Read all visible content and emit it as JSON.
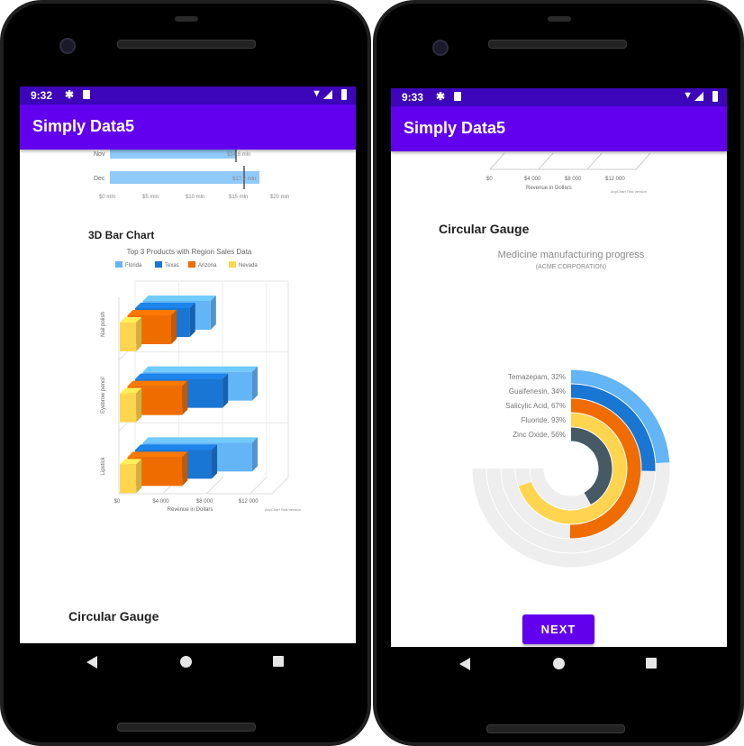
{
  "left_screen": {
    "status": {
      "time": "9:32"
    },
    "app_title": "Simply Data5",
    "prev_chart": {
      "categories": [
        "Nov",
        "Dec"
      ],
      "bar_labels": [
        "$14.8 mln",
        "$17.2 mln"
      ],
      "x_ticks": [
        "$0 mln",
        "$5 mln",
        "$10 mln",
        "$15 mln",
        "$20 mln"
      ]
    },
    "bar3d_section_title": "3D Bar Chart",
    "next_section_title": "Circular Gauge"
  },
  "right_screen": {
    "status": {
      "time": "9:33"
    },
    "app_title": "Simply Data5",
    "prev_chart": {
      "x_ticks": [
        "$0",
        "$4 000",
        "$8 000",
        "$12 000"
      ],
      "xlabel": "Revenue in Dollars",
      "credit": "AnyChart Trial Version"
    },
    "gauge_section_title": "Circular Gauge",
    "next_button": "NEXT"
  },
  "icons": {
    "settings": "gear-icon",
    "sd_card": "sd-card-icon",
    "wifi": "wifi-icon",
    "cell": "cell-signal-icon",
    "battery": "battery-icon",
    "back": "back-icon",
    "home": "home-icon",
    "recents": "recents-icon"
  },
  "colors": {
    "status_bar": "#3d05b9",
    "app_bar": "#6200ee",
    "button": "#6200ee"
  },
  "chart_data": [
    {
      "type": "bar",
      "title": "Top 3 Products with Region Sales Data",
      "categories": [
        "Nail polish",
        "Eyebrow pencil",
        "Lipstick"
      ],
      "series": [
        {
          "name": "Florida",
          "values": [
            6200,
            10000,
            10000
          ],
          "color": "#64b5f6"
        },
        {
          "name": "Texas",
          "values": [
            5000,
            8000,
            7000
          ],
          "color": "#1976d2"
        },
        {
          "name": "Arizona",
          "values": [
            4000,
            5000,
            5000
          ],
          "color": "#ef6c00"
        },
        {
          "name": "Nevada",
          "values": [
            1500,
            1500,
            1500
          ],
          "color": "#ffd54f"
        }
      ],
      "x_ticks": [
        "$0",
        "$4 000",
        "$8 000",
        "$12 000"
      ],
      "xlabel": "Revenue in Dollars",
      "xlim": [
        0,
        14000
      ],
      "legend": "top",
      "credit": "AnyChart Trial Version"
    },
    {
      "type": "gauge",
      "title": "Medicine manufacturing progress",
      "subtitle": "(ACME CORPORATION)",
      "series": [
        {
          "name": "Temazepam",
          "label": "Temazepam, 32%",
          "value": 32,
          "color": "#64b5f6"
        },
        {
          "name": "Guaifenesin",
          "label": "Guaifenesin, 34%",
          "value": 34,
          "color": "#1976d2"
        },
        {
          "name": "Salicylic Acid",
          "label": "Salicylic Acid, 67%",
          "value": 67,
          "color": "#ef6c00"
        },
        {
          "name": "Fluoride",
          "label": "Fluoride, 93%",
          "value": 93,
          "color": "#ffd54f"
        },
        {
          "name": "Zinc Oxide",
          "label": "Zinc Oxide, 56%",
          "value": 56,
          "color": "#455a64"
        }
      ],
      "range": [
        0,
        100
      ]
    }
  ]
}
